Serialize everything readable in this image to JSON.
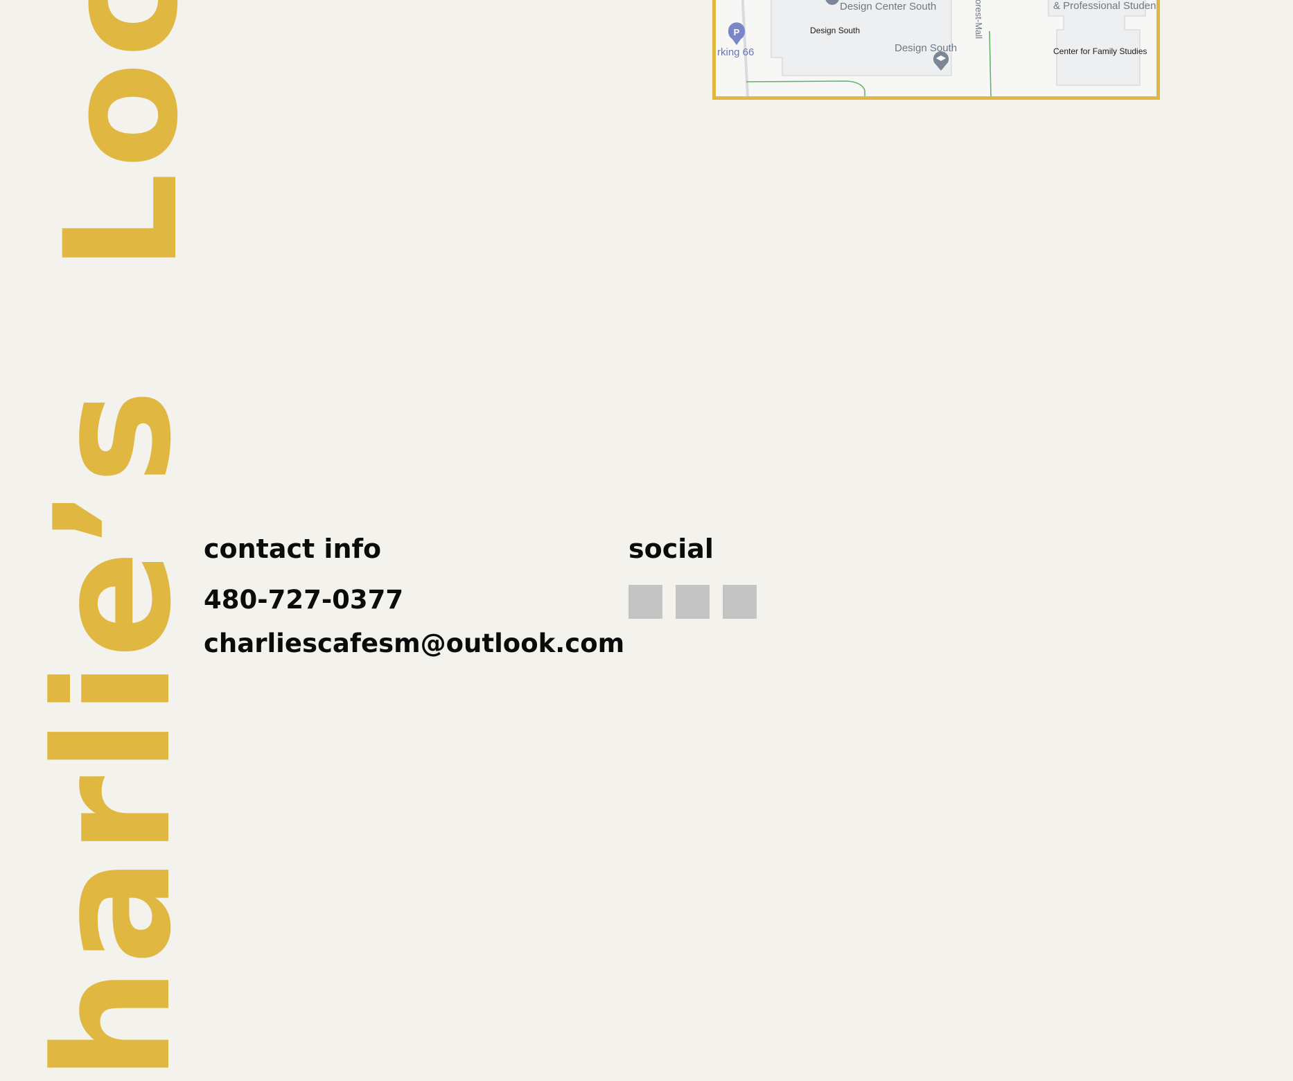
{
  "headings": {
    "locations_fragment": "Loca",
    "charlies_fragment": "harlie’s"
  },
  "map": {
    "labels": {
      "design_center_south": "Design Center South",
      "design_south_small": "Design South",
      "design_south": "Design South",
      "parking": "rking 66",
      "forest_mall": "orest-Mall",
      "professional_students": "& Professional Studen",
      "family_studies": "Center for Family Studies"
    },
    "parking_marker": "P",
    "icons": [
      "map-pin-icon",
      "graduation-cap-icon",
      "parking-icon"
    ]
  },
  "contact": {
    "title": "contact info",
    "phone": "480-727-0377",
    "email": "charliescafesm@outlook.com"
  },
  "social": {
    "title": "social",
    "icons": [
      "social-icon-1",
      "social-icon-2",
      "social-icon-3"
    ]
  },
  "colors": {
    "accent": "#dfb741",
    "background": "#f3f2ec",
    "text": "#0b0b0b",
    "icon_placeholder": "#c4c4c4"
  }
}
